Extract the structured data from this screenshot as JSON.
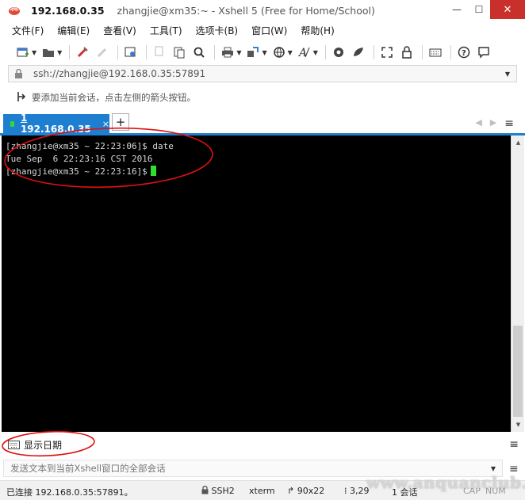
{
  "window": {
    "title_host": "192.168.0.35",
    "title_rest": "zhangjie@xm35:~ - Xshell 5 (Free for Home/School)",
    "minimize": "—",
    "maximize": "☐",
    "close": "✕"
  },
  "menu": {
    "items": [
      "文件(F)",
      "编辑(E)",
      "查看(V)",
      "工具(T)",
      "选项卡(B)",
      "窗口(W)",
      "帮助(H)"
    ]
  },
  "address": {
    "value": "ssh://zhangjie@192.168.0.35:57891"
  },
  "hint": {
    "text": "要添加当前会话，点击左侧的箭头按钮。"
  },
  "tabs": {
    "active_number": "1",
    "active_label": "192.168.0.35",
    "close": "×",
    "add": "+"
  },
  "terminal": {
    "lines": [
      "[zhangjie@xm35 ~ 22:23:06]$ date",
      "Tue Sep  6 22:23:16 CST 2016",
      "[zhangjie@xm35 ~ 22:23:16]$"
    ]
  },
  "quick_command": {
    "label": "显示日期"
  },
  "compose": {
    "placeholder": "发送文本到当前Xshell窗口的全部会话"
  },
  "status": {
    "connection": "已连接 192.168.0.35:57891。",
    "protocol": "SSH2",
    "terminal_type": "xterm",
    "size": "90x22",
    "cursor_pos": "3,29",
    "sessions": "1 会话",
    "caps": "CAP",
    "num": "NUM"
  },
  "watermark": "www.anquanclub.cn",
  "colors": {
    "tab_active": "#1e7fd0",
    "terminal_bg": "#000000",
    "terminal_fg": "#d8d8d8",
    "cursor": "#2fe02f",
    "annotation": "#e01010"
  }
}
